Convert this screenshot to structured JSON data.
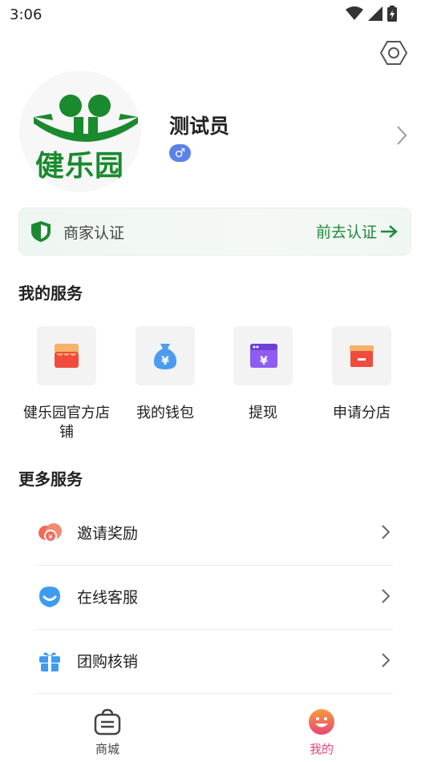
{
  "status": {
    "time": "3:06"
  },
  "profile": {
    "logo_text": "健乐园",
    "name": "测试员",
    "gender_symbol": "♂"
  },
  "merchant": {
    "label": "商家认证",
    "cta": "前去认证"
  },
  "services": {
    "title": "我的服务",
    "items": [
      {
        "label": "健乐园官方店铺",
        "icon": "shop-icon"
      },
      {
        "label": "我的钱包",
        "icon": "money-bag-icon"
      },
      {
        "label": "提现",
        "icon": "withdraw-icon"
      },
      {
        "label": "申请分店",
        "icon": "branch-store-icon"
      }
    ]
  },
  "more": {
    "title": "更多服务",
    "items": [
      {
        "label": "邀请奖励",
        "icon": "invite-reward-icon"
      },
      {
        "label": "在线客服",
        "icon": "customer-service-icon"
      },
      {
        "label": "团购核销",
        "icon": "gift-box-icon"
      }
    ]
  },
  "tabs": [
    {
      "label": "商城",
      "icon": "bag-icon",
      "active": false
    },
    {
      "label": "我的",
      "icon": "smiley-icon",
      "active": true
    }
  ],
  "colors": {
    "brand_green": "#1f8a3b",
    "active_tab": "#e8457a",
    "inactive_tab": "#444444"
  }
}
